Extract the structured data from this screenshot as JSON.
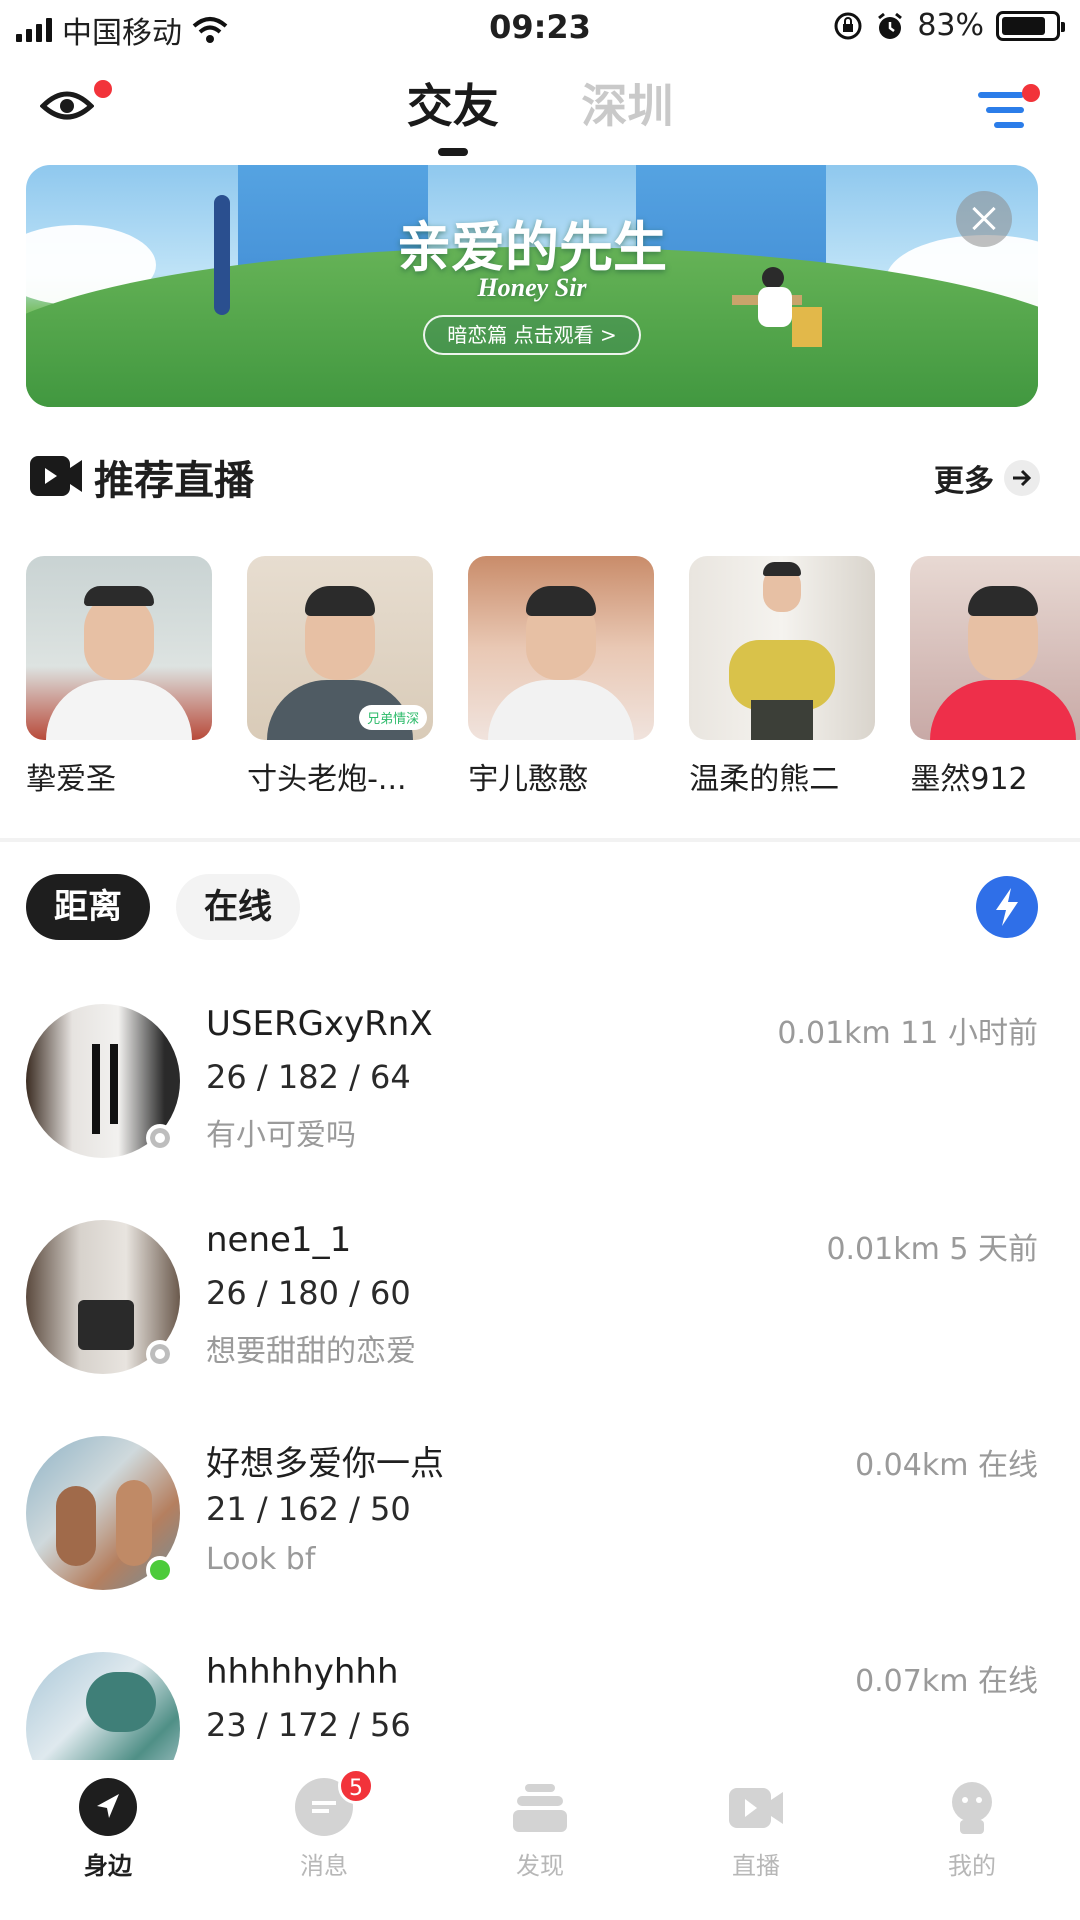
{
  "status_bar": {
    "carrier": "中国移动",
    "time": "09:23",
    "battery": "83%",
    "battery_level": 0.83
  },
  "header": {
    "tabs": [
      {
        "label": "交友",
        "active": true
      },
      {
        "label": "深圳",
        "active": false
      }
    ]
  },
  "banner": {
    "title": "亲爱的先生",
    "subtitle": "Honey Sir",
    "cta": "暗恋篇  点击观看 >"
  },
  "live_section": {
    "title": "推荐直播",
    "more_label": "更多",
    "cards": [
      {
        "name": "挚爱圣"
      },
      {
        "name": "寸头老炮-...",
        "tag": "兄弟情深"
      },
      {
        "name": "宇儿憨憨"
      },
      {
        "name": "温柔的熊二"
      },
      {
        "name": "墨然912"
      }
    ]
  },
  "filters": {
    "chips": [
      {
        "label": "距离",
        "active": true
      },
      {
        "label": "在线",
        "active": false
      }
    ]
  },
  "users": [
    {
      "name": "USERGxyRnX",
      "meta": "0.01km  11 小时前",
      "stats": "26 / 182 / 64",
      "bio": "有小可爱吗",
      "online": false
    },
    {
      "name": "nene1_1",
      "meta": "0.01km  5 天前",
      "stats": "26 / 180 / 60",
      "bio": "想要甜甜的恋爱",
      "online": false
    },
    {
      "name": "好想多爱你一点",
      "meta": "0.04km  在线",
      "stats": "21 / 162 / 50",
      "bio": "Look bf",
      "online": true
    },
    {
      "name": "hhhhhyhhh",
      "meta": "0.07km  在线",
      "stats": "23 / 172 / 56",
      "bio": "",
      "online": true
    }
  ],
  "bottom_nav": {
    "items": [
      {
        "label": "身边",
        "icon": "navigation-arrow-icon",
        "active": true
      },
      {
        "label": "消息",
        "icon": "chat-bubble-icon",
        "active": false,
        "badge": "5"
      },
      {
        "label": "发现",
        "icon": "stack-icon",
        "active": false
      },
      {
        "label": "直播",
        "icon": "video-camera-icon",
        "active": false
      },
      {
        "label": "我的",
        "icon": "profile-icon",
        "active": false
      }
    ]
  },
  "colors": {
    "accent_blue": "#2b7de9",
    "notification_red": "#f2333a",
    "online_green": "#4ccb3a"
  }
}
